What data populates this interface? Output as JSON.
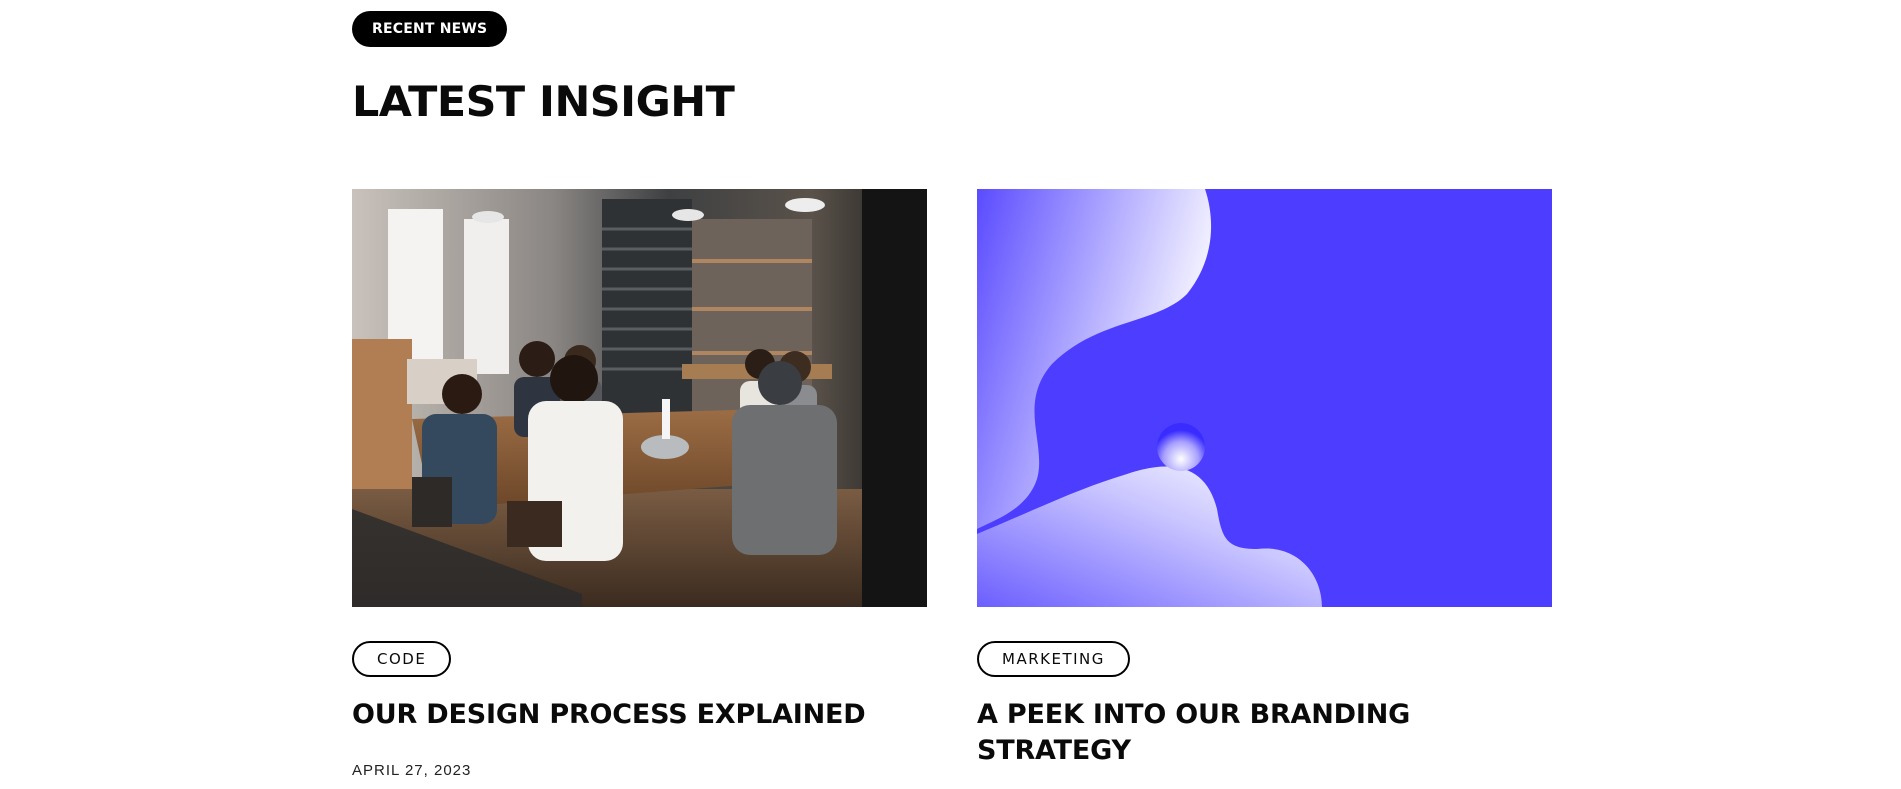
{
  "section": {
    "eyebrow": "RECENT NEWS",
    "title": "LATEST INSIGHT"
  },
  "posts": [
    {
      "tag": "CODE",
      "title": "OUR DESIGN PROCESS EXPLAINED",
      "date": "APRIL 27, 2023",
      "image": "team-meeting-photo"
    },
    {
      "tag": "MARKETING",
      "title": "A PEEK INTO OUR BRANDING STRATEGY",
      "date": "",
      "image": "abstract-blue-wave"
    }
  ],
  "colors": {
    "accent_blue": "#4d3dff",
    "black": "#000000",
    "white": "#ffffff"
  }
}
